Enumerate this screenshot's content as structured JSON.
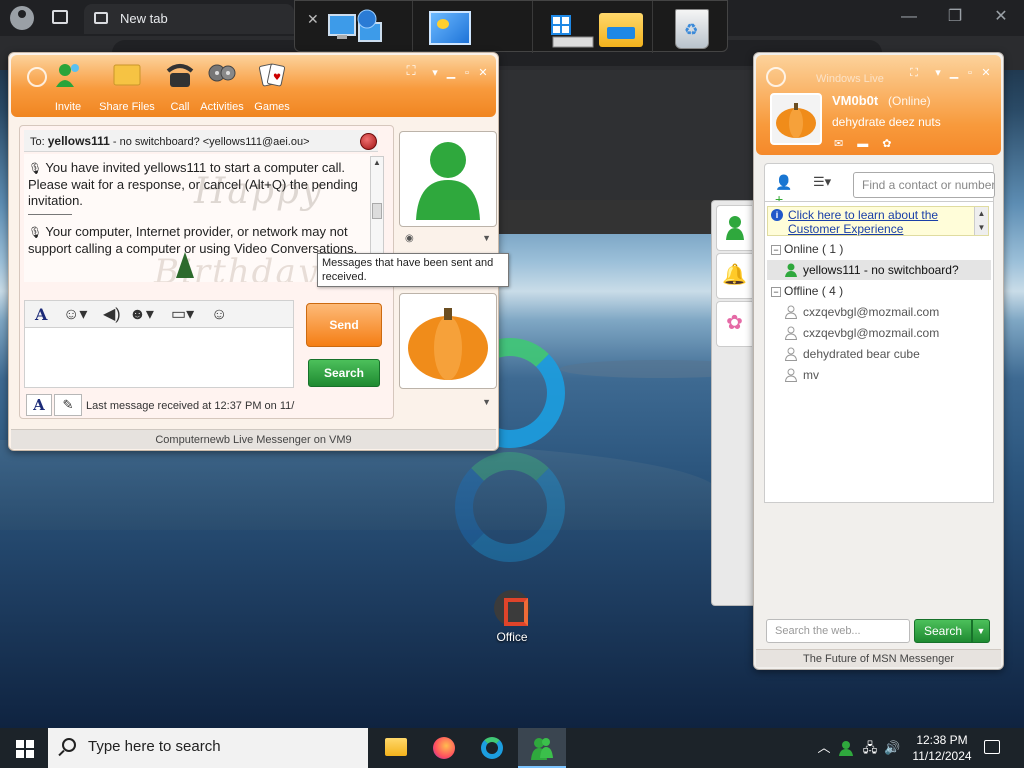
{
  "browser": {
    "tab_title": "New tab",
    "controls": {
      "minimize": "—",
      "restore": "❐",
      "close": "✕"
    }
  },
  "conversation": {
    "toolbar": [
      {
        "label": "Invite",
        "icon": "invite-icon"
      },
      {
        "label": "Share Files",
        "icon": "share-files-icon"
      },
      {
        "label": "Call",
        "icon": "call-icon"
      },
      {
        "label": "Activities",
        "icon": "activities-icon"
      },
      {
        "label": "Games",
        "icon": "games-icon"
      }
    ],
    "to_label": "To:",
    "to_name": "yellows111",
    "to_detail": "- no switchboard? <yellows111@aei.ou>",
    "messages": [
      "You have invited yellows111 to start a computer call. Please wait for a response, or cancel (Alt+Q) the pending invitation.",
      "Your computer, Internet provider, or network may not support calling a computer or using Video Conversations."
    ],
    "watermark_line1": "Happy",
    "watermark_line2": "Birthday",
    "send_label": "Send",
    "search_label": "Search",
    "last_message": "Last message received at 12:37 PM on 11/",
    "footer": "Computernewb Live Messenger on VM9",
    "tooltip": "Messages that have been sent and received."
  },
  "contact_list": {
    "title": "Windows Live",
    "display_name": "VM0b0t",
    "status": "(Online)",
    "personal_message": "dehydrate deez nuts",
    "find_placeholder": "Find a contact or number...",
    "banner_text": "Click here to learn about the Customer Experience",
    "groups": [
      {
        "label": "Online ( 1 )",
        "contacts": [
          "yellows111 - no switchboard?"
        ]
      },
      {
        "label": "Offline ( 4 )",
        "contacts": [
          "cxzqevbgl@mozmail.com",
          "cxzqevbgl@mozmail.com",
          "dehydrated bear cube",
          "mv"
        ]
      }
    ],
    "search_placeholder": "Search the web...",
    "search_button": "Search",
    "footer": "The Future of MSN Messenger"
  },
  "desktop": {
    "office_label": "Office"
  },
  "taskbar": {
    "search_placeholder": "Type here to search",
    "time": "12:38 PM",
    "date": "11/12/2024"
  },
  "colors": {
    "msn_orange": "#f89a3c",
    "msn_green": "#1f8a31",
    "taskbar": "#1c2329"
  }
}
